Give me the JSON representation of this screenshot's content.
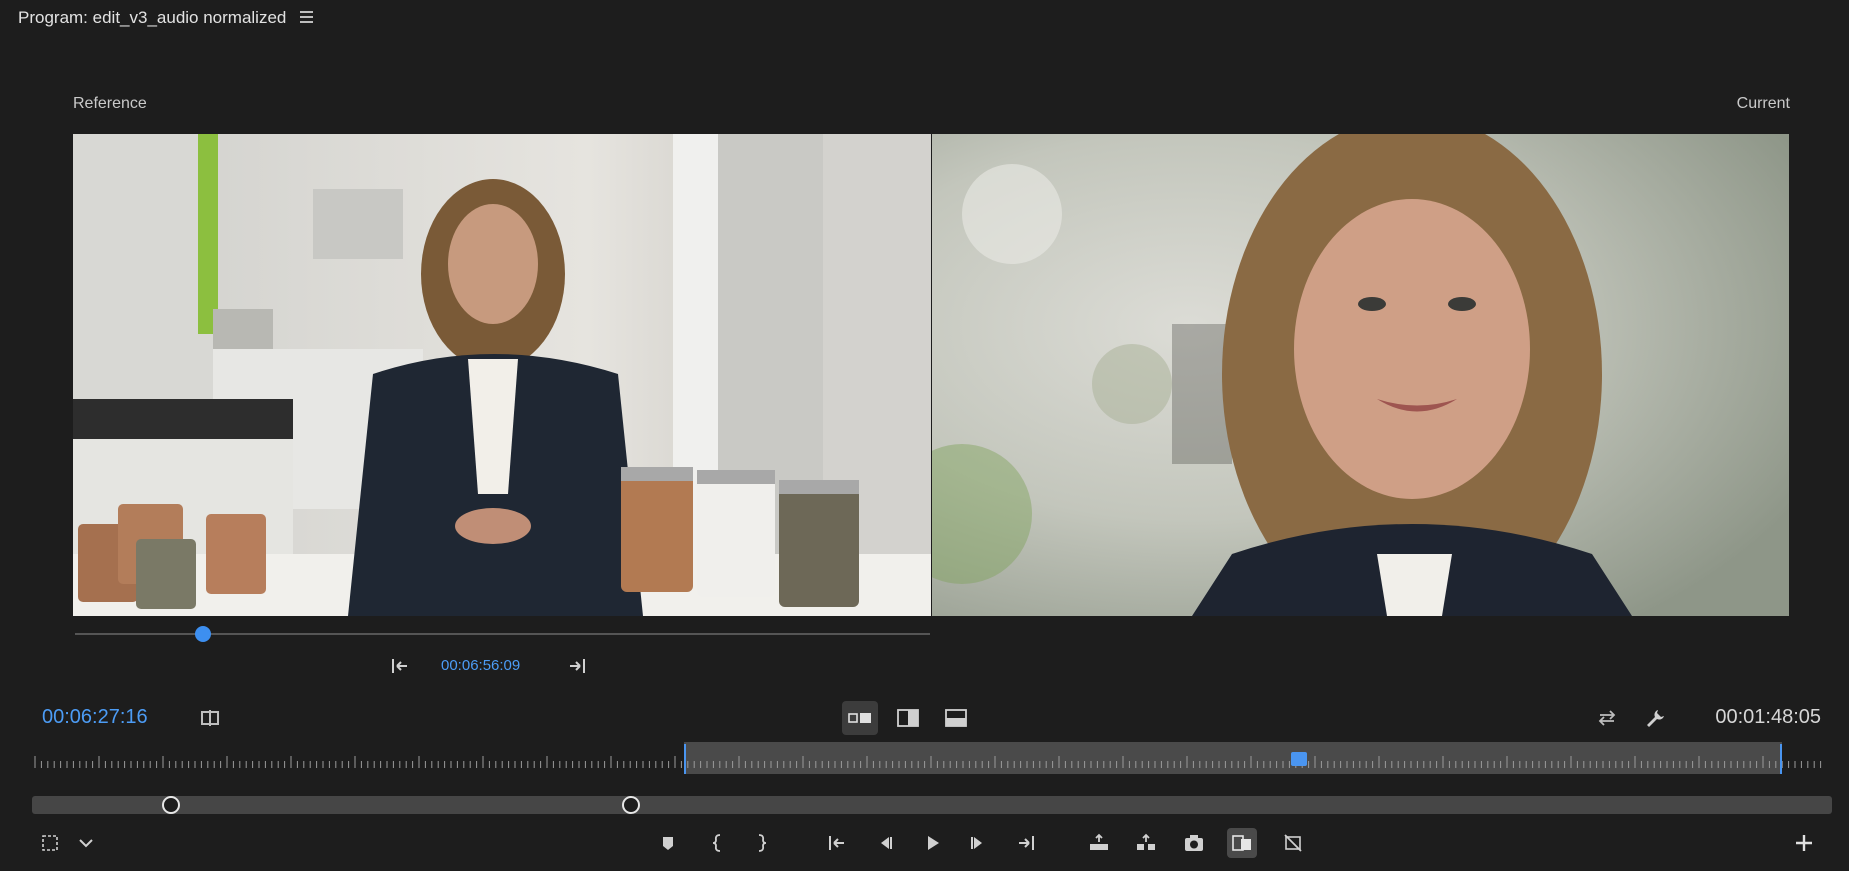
{
  "panel": {
    "title": "Program: edit_v3_audio normalized"
  },
  "compare": {
    "reference_label": "Reference",
    "current_label": "Current",
    "reference_timecode": "00:06:56:09",
    "reference_scrub_position": 0.15
  },
  "transport": {
    "current_timecode": "00:06:27:16",
    "duration_timecode": "00:01:48:05",
    "playhead_position": 0.56
  },
  "colors": {
    "accent": "#4c9cf5",
    "panel_bg": "#1d1d1d",
    "inout_bar": "#4a4a4a"
  },
  "icons": {
    "panel_menu": "hamburger-icon",
    "go_to_in": "go-to-in-icon",
    "go_to_out": "go-to-out-icon",
    "compare_toggle": "compare-toggle-icon",
    "side_by_side": "side-by-side-icon",
    "vertical_split": "vertical-split-icon",
    "horizontal_split": "horizontal-split-icon",
    "swap": "swap-icon",
    "settings": "wrench-icon",
    "safe_margins": "safe-margins-icon",
    "chevron": "chevron-down-icon",
    "add_marker": "marker-icon",
    "mark_in": "mark-in-icon",
    "mark_out": "mark-out-icon",
    "step_back": "step-back-icon",
    "play": "play-icon",
    "step_forward": "step-forward-icon",
    "lift": "lift-icon",
    "extract": "extract-icon",
    "export_frame": "camera-icon",
    "comparison_view": "comparison-view-icon",
    "proxy": "proxy-icon",
    "add_button": "plus-icon"
  }
}
